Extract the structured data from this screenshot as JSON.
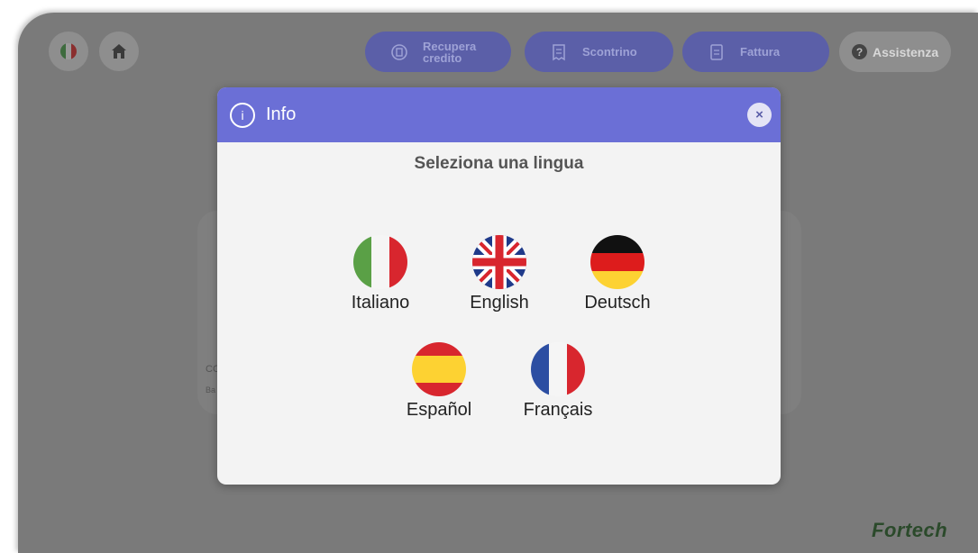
{
  "topbar": {
    "language_flag_icon": "italy-flag-icon",
    "home_icon": "home-icon",
    "recupera_label_line1": "Recupera",
    "recupera_label_line2": "credito",
    "scontrino_label": "Scontrino",
    "fattura_label": "Fattura",
    "assistenza_label": "Assistenza",
    "assistenza_icon_glyph": "?"
  },
  "background": {
    "card_text_1": "CC",
    "card_text_2": "Ba"
  },
  "modal": {
    "title": "Info",
    "info_icon_glyph": "i",
    "close_glyph": "×",
    "subtitle": "Seleziona una lingua",
    "languages": [
      {
        "label": "Italiano",
        "flag": "italy-flag-icon"
      },
      {
        "label": "English",
        "flag": "uk-flag-icon"
      },
      {
        "label": "Deutsch",
        "flag": "germany-flag-icon"
      },
      {
        "label": "Español",
        "flag": "spain-flag-icon"
      },
      {
        "label": "Français",
        "flag": "france-flag-icon"
      }
    ]
  },
  "brand": "Fortech",
  "colors": {
    "accent": "#6b6fd6",
    "overlay": "#7a7a7a",
    "pill": "#5b5fa8"
  }
}
